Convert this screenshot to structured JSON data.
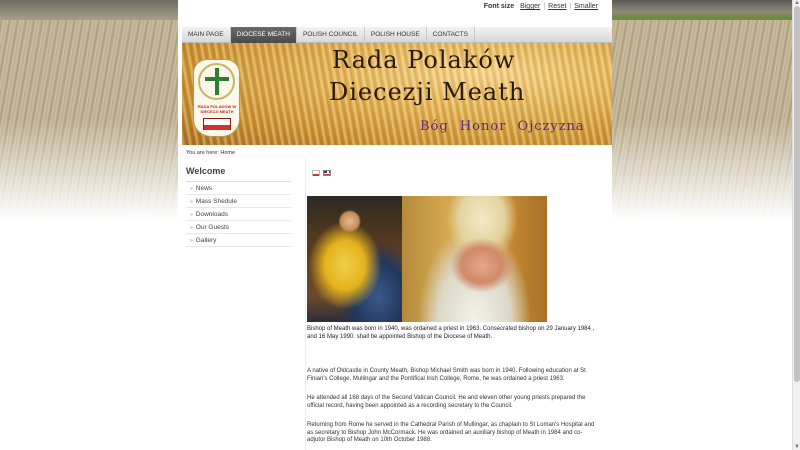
{
  "font_size": {
    "label": "Font size",
    "bigger": "Bigger",
    "reset": "Reset",
    "smaller": "Smaller"
  },
  "nav": {
    "items": [
      {
        "label": "MAIN PAGE"
      },
      {
        "label": "DIOCESE MEATH"
      },
      {
        "label": "POLISH COUNCIL"
      },
      {
        "label": "POLISH HOUSE"
      },
      {
        "label": "CONTACTS"
      }
    ],
    "active_index": 1
  },
  "banner": {
    "title_line1": "Rada Polaków",
    "title_line2": "Diecezji Meath",
    "motto": "Bóg Honor Ojczyzna",
    "emblem_text": "RADA POLAKÓW W DIECEZJI MEATH"
  },
  "breadcrumb": "You are here: Home",
  "sidebar": {
    "title": "Welcome",
    "links": [
      {
        "label": "News"
      },
      {
        "label": "Mass Shedule"
      },
      {
        "label": "Downloads"
      },
      {
        "label": "Our Guests"
      },
      {
        "label": "Gallery"
      }
    ]
  },
  "content": {
    "photo_caption": "Bishop of Meath was born in 1940, was ordained a priest in 1963. Consecrated bishop on 29 January 1984 , and 16 May 1990. shall be appointed Bishop of the Diocese of Meath.",
    "paragraphs": [
      "A native of Oldcastle in County Meath, Bishop Michael Smith was born in 1940. Following education at St Finian's College, Mullingar and the Pontifical Irish College, Rome, he was ordained a priest 1963.",
      "He attended all 168 days of the Second Vatican Council. He and eleven other young priests prepared the official record, having been appointed as a recording secretary to the Council.",
      "Returning from Rome he served in the Cathedral Parish of Mullingar, as chaplain to St Loman's Hospital and as secretary to Bishop John McCormack. He was ordained an auxiliary bishop of Meath in 1984 and co-adjutor Bishop of Meath on 10th October 1988."
    ]
  },
  "colors": {
    "nav_active": "#555555",
    "motto": "#5b2a7a",
    "banner": "#e2b253"
  }
}
